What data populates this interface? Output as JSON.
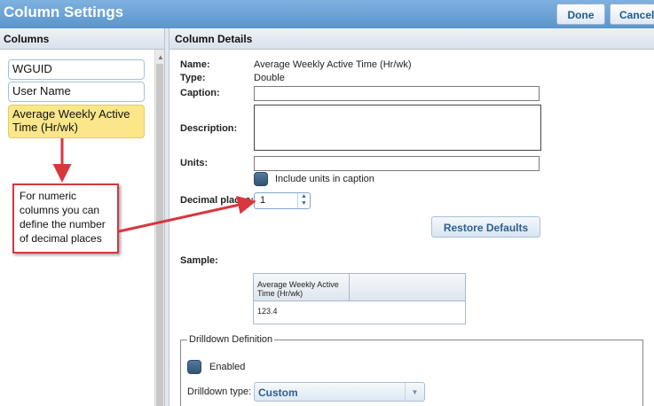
{
  "window": {
    "title": "Column Settings",
    "done_label": "Done",
    "cancel_label": "Cancel"
  },
  "left_panel": {
    "header": "Columns",
    "items": [
      {
        "label": "WGUID"
      },
      {
        "label": "User Name"
      },
      {
        "label": "Average Weekly Active Time (Hr/wk)",
        "selected": true
      }
    ]
  },
  "details": {
    "header": "Column Details",
    "name_label": "Name:",
    "name_value": "Average Weekly Active Time (Hr/wk)",
    "type_label": "Type:",
    "type_value": "Double",
    "caption_label": "Caption:",
    "caption_value": "",
    "description_label": "Description:",
    "description_value": "",
    "units_label": "Units:",
    "units_value": "",
    "include_units_label": "Include units in caption",
    "decimal_label": "Decimal places:",
    "decimal_value": "1",
    "restore_label": "Restore Defaults",
    "sample_label": "Sample:",
    "sample_header": "Average Weekly Active Time (Hr/wk)",
    "sample_value": "123.4",
    "drilldown_legend": "Drilldown Definition",
    "enabled_label": "Enabled",
    "drilldown_type_label": "Drilldown type:",
    "drilldown_type_value": "Custom"
  },
  "annotation": {
    "text": "For numeric columns you can define the number of decimal places",
    "border_color": "#d9363e"
  },
  "colors": {
    "title_bar": "#5a95cc",
    "selected_item": "#fbe78a",
    "accent_text": "#2f5f8f"
  }
}
